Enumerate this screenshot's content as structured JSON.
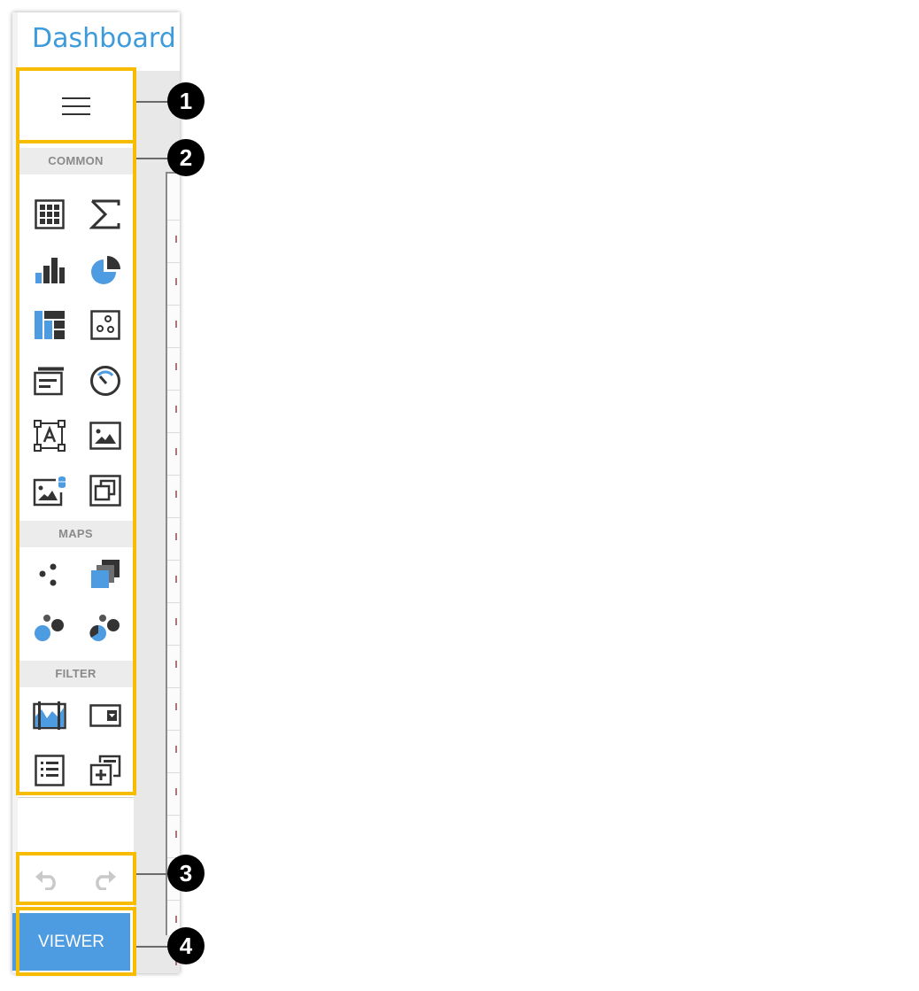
{
  "app": {
    "title": "Dashboard"
  },
  "toolbox": {
    "sections": [
      {
        "label": "COMMON"
      },
      {
        "label": "MAPS"
      },
      {
        "label": "FILTER"
      }
    ]
  },
  "icons": {
    "menu": "hamburger-menu-icon",
    "common": [
      "grid-icon",
      "sigma-card-icon",
      "bar-chart-icon",
      "pie-chart-icon",
      "treemap-icon",
      "scatter-chart-icon",
      "cards-icon",
      "gauge-icon",
      "text-box-icon",
      "image-icon",
      "bound-image-icon",
      "group-icon"
    ],
    "maps": [
      "geo-point-map-icon",
      "choropleth-map-icon",
      "bubble-map-icon",
      "pie-map-icon"
    ],
    "filter": [
      "range-filter-icon",
      "combo-box-icon",
      "list-box-icon",
      "tree-view-icon"
    ],
    "undo": "undo-icon",
    "redo": "redo-icon"
  },
  "viewer_label": "VIEWER",
  "callouts": [
    "1",
    "2",
    "3",
    "4"
  ],
  "colors": {
    "accent": "#4d9be0",
    "title": "#3d9bdc",
    "highlight": "#f7bb00",
    "icon_dark": "#333333"
  }
}
